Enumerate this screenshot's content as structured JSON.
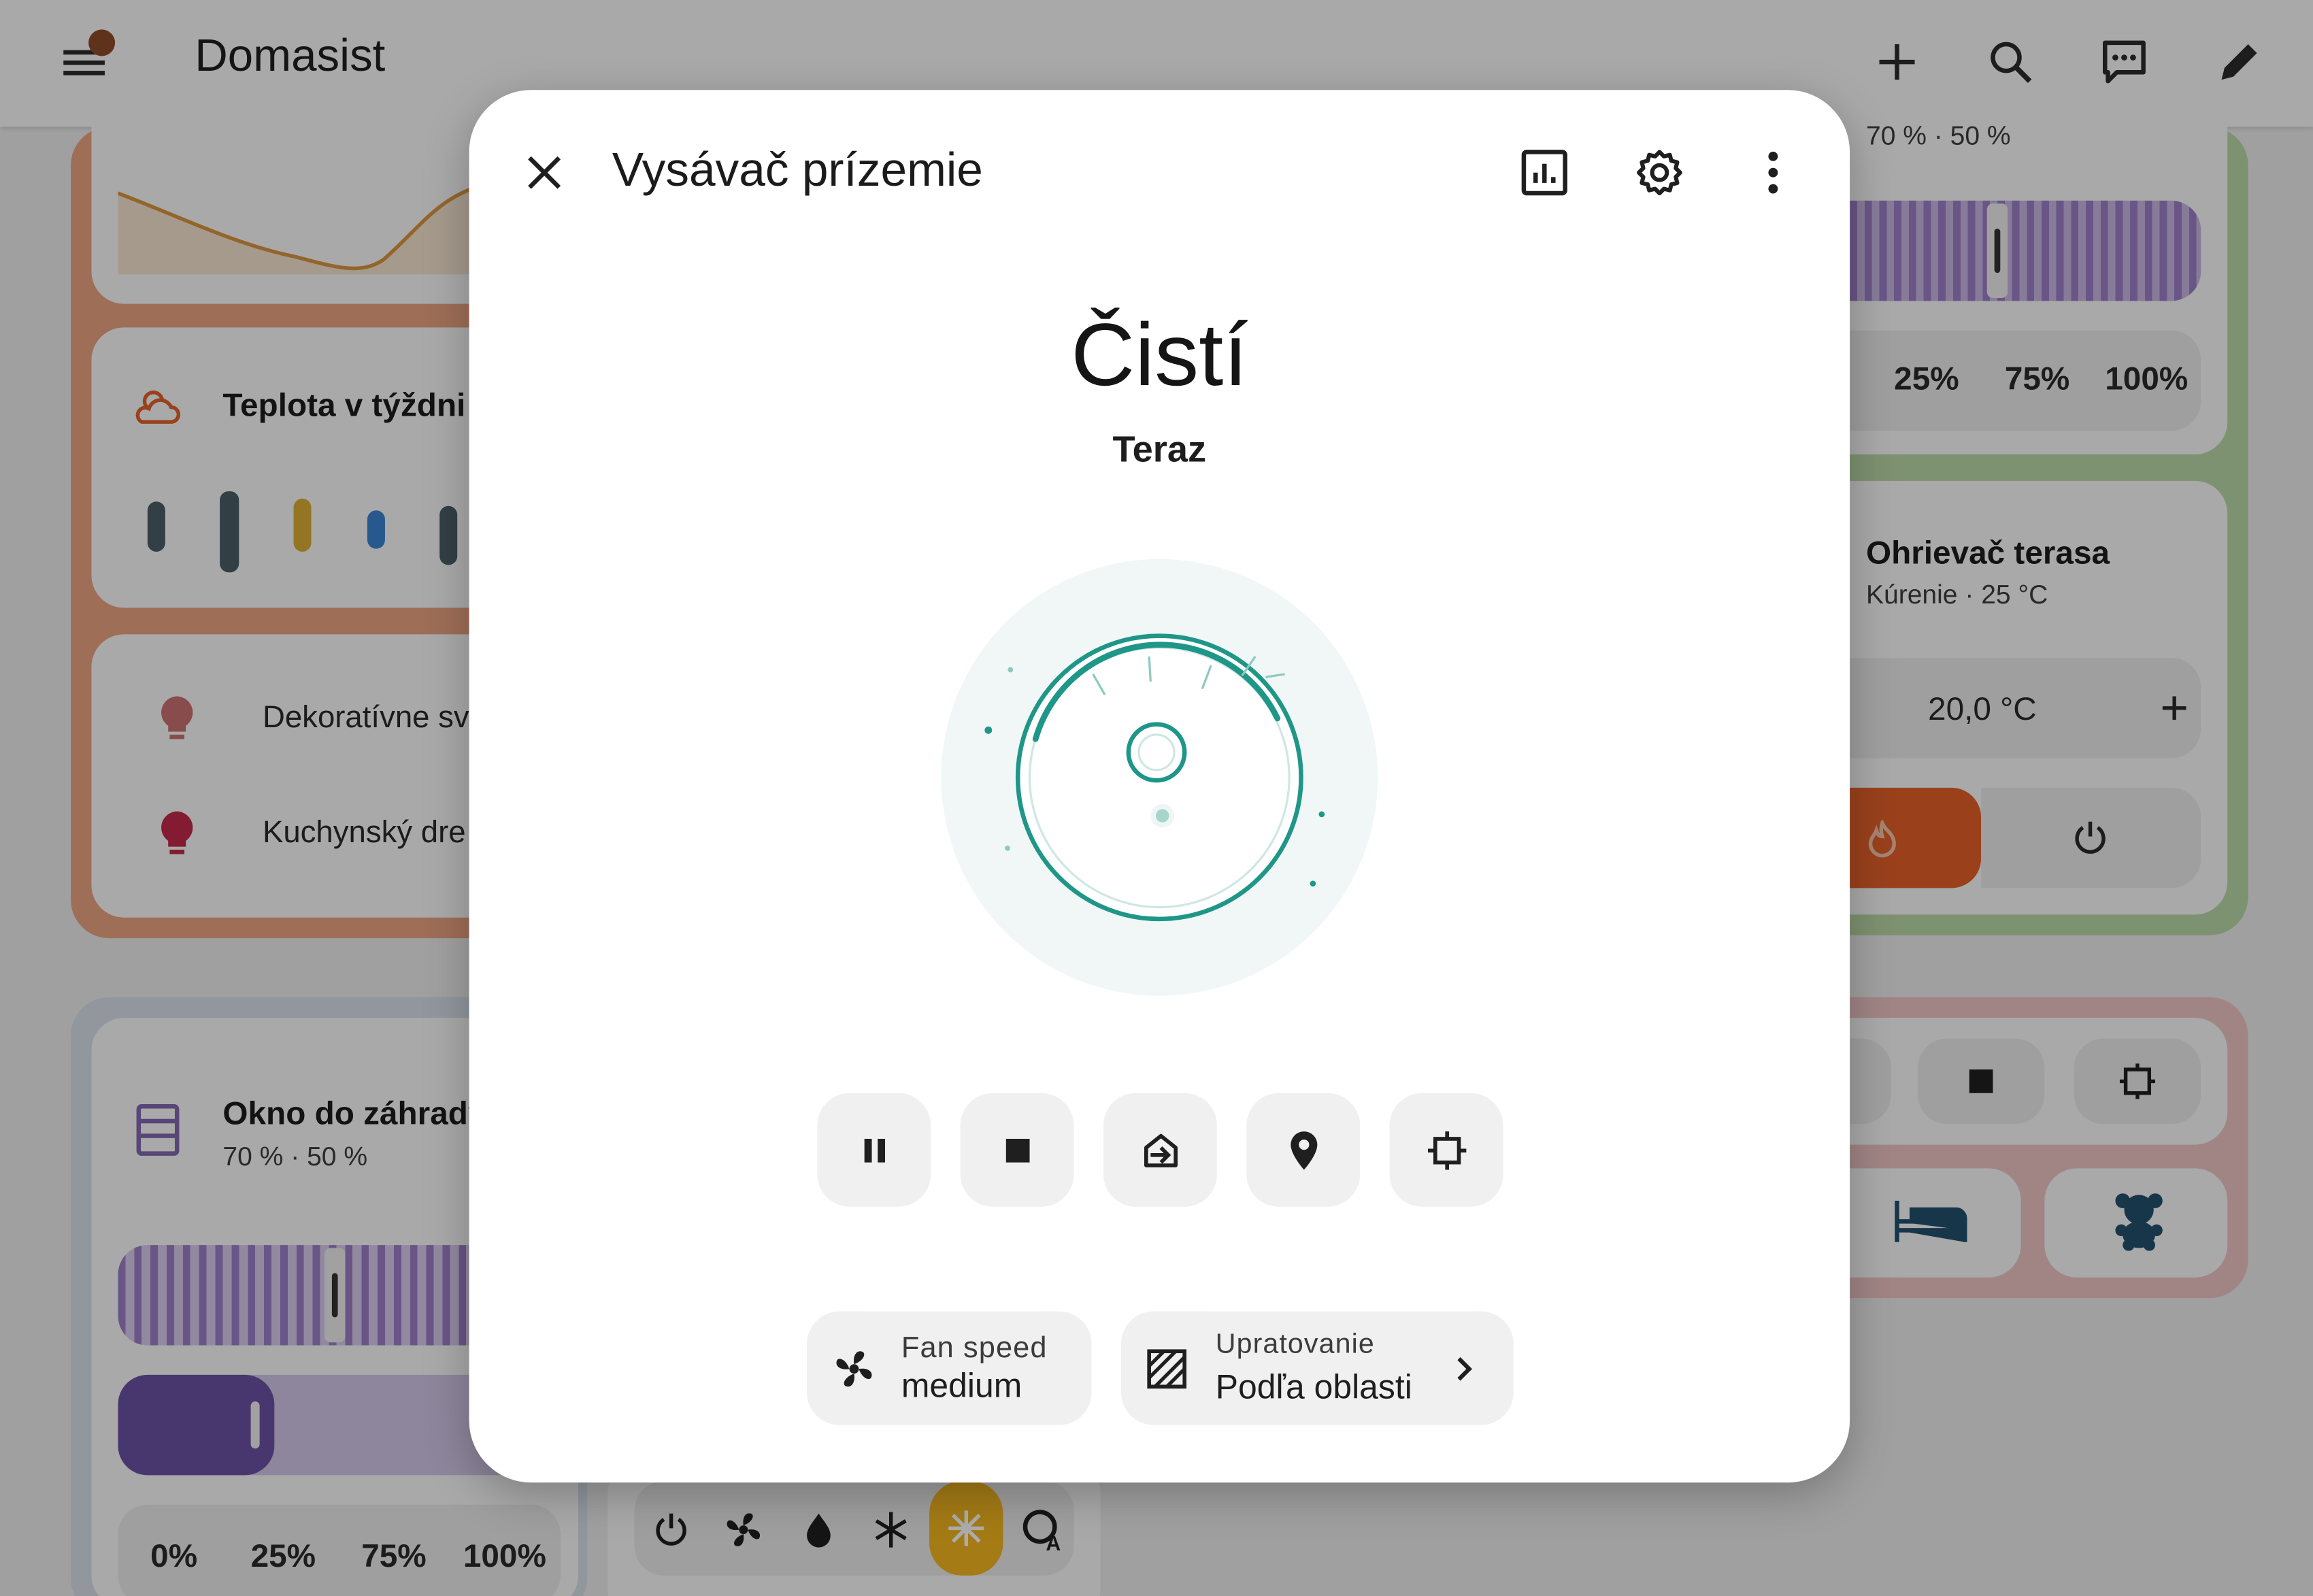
{
  "app": {
    "title": "Domasist"
  },
  "dashboard": {
    "top_right_cover": {
      "state": "70 % · 50 %",
      "presets": [
        "25%",
        "75%",
        "100%"
      ]
    },
    "temp_week": {
      "title": "Teplota v týždni"
    },
    "lights": [
      {
        "label": "Dekoratívne sv"
      },
      {
        "label": "Kuchynský dre"
      }
    ],
    "heater": {
      "title": "Ohrievač terasa",
      "state": "Kúrenie · 25 °C",
      "target": "20,0 °C"
    },
    "window": {
      "title": "Okno do záhrady",
      "state": "70 % · 50 %",
      "presets": [
        "0%",
        "25%",
        "75%",
        "100%"
      ]
    }
  },
  "dialog": {
    "title": "Vysávač prízemie",
    "state": "Čistí",
    "substate": "Teraz",
    "fan_speed": {
      "label": "Fan speed",
      "value": "medium"
    },
    "cleaning": {
      "label": "Upratovanie",
      "value": "Podľa oblasti"
    }
  },
  "colors": {
    "accent_teal": "#1e9688",
    "cover_purple": "#9b7fc8",
    "heat_orange": "#e4602a",
    "warm_section": "#e8a07e",
    "green_section": "#b9d9a6",
    "climate_active": "#f2b51f"
  }
}
